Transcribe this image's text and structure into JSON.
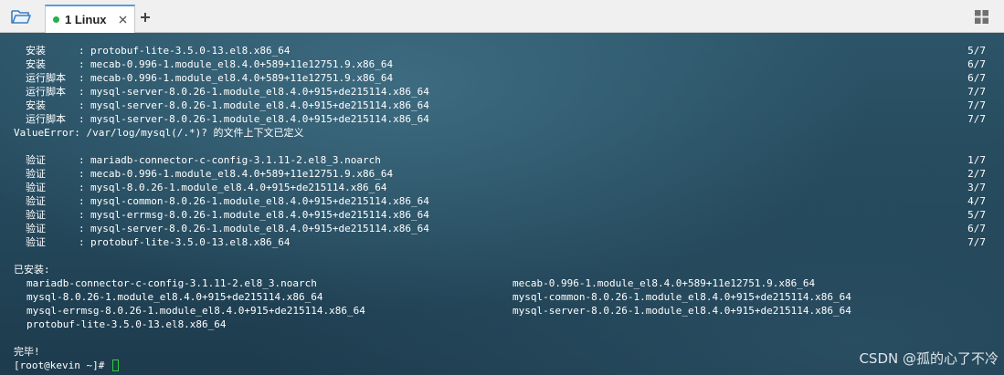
{
  "tabbar": {
    "tab_label": "1 Linux",
    "status_color": "#22b14c",
    "accent_color": "#5b9bd5"
  },
  "transaction": [
    {
      "action": "安装",
      "package": "protobuf-lite-3.5.0-13.el8.x86_64",
      "progress": "5/7"
    },
    {
      "action": "安装",
      "package": "mecab-0.996-1.module_el8.4.0+589+11e12751.9.x86_64",
      "progress": "6/7"
    },
    {
      "action": "运行脚本",
      "package": "mecab-0.996-1.module_el8.4.0+589+11e12751.9.x86_64",
      "progress": "6/7"
    },
    {
      "action": "运行脚本",
      "package": "mysql-server-8.0.26-1.module_el8.4.0+915+de215114.x86_64",
      "progress": "7/7"
    },
    {
      "action": "安装",
      "package": "mysql-server-8.0.26-1.module_el8.4.0+915+de215114.x86_64",
      "progress": "7/7"
    },
    {
      "action": "运行脚本",
      "package": "mysql-server-8.0.26-1.module_el8.4.0+915+de215114.x86_64",
      "progress": "7/7"
    }
  ],
  "error_line": "ValueError: /var/log/mysql(/.*)? 的文件上下文已定义",
  "verify": [
    {
      "action": "验证",
      "package": "mariadb-connector-c-config-3.1.11-2.el8_3.noarch",
      "progress": "1/7"
    },
    {
      "action": "验证",
      "package": "mecab-0.996-1.module_el8.4.0+589+11e12751.9.x86_64",
      "progress": "2/7"
    },
    {
      "action": "验证",
      "package": "mysql-8.0.26-1.module_el8.4.0+915+de215114.x86_64",
      "progress": "3/7"
    },
    {
      "action": "验证",
      "package": "mysql-common-8.0.26-1.module_el8.4.0+915+de215114.x86_64",
      "progress": "4/7"
    },
    {
      "action": "验证",
      "package": "mysql-errmsg-8.0.26-1.module_el8.4.0+915+de215114.x86_64",
      "progress": "5/7"
    },
    {
      "action": "验证",
      "package": "mysql-server-8.0.26-1.module_el8.4.0+915+de215114.x86_64",
      "progress": "6/7"
    },
    {
      "action": "验证",
      "package": "protobuf-lite-3.5.0-13.el8.x86_64",
      "progress": "7/7"
    }
  ],
  "installed_header": "已安装:",
  "installed": [
    [
      "mariadb-connector-c-config-3.1.11-2.el8_3.noarch",
      "mecab-0.996-1.module_el8.4.0+589+11e12751.9.x86_64"
    ],
    [
      "mysql-8.0.26-1.module_el8.4.0+915+de215114.x86_64",
      "mysql-common-8.0.26-1.module_el8.4.0+915+de215114.x86_64"
    ],
    [
      "mysql-errmsg-8.0.26-1.module_el8.4.0+915+de215114.x86_64",
      "mysql-server-8.0.26-1.module_el8.4.0+915+de215114.x86_64"
    ],
    [
      "protobuf-lite-3.5.0-13.el8.x86_64",
      ""
    ]
  ],
  "done_text": "完毕!",
  "prompt": "[root@kevin ~]# ",
  "cursor_color": "#2ecc40",
  "watermark": "CSDN @孤的心了不冷"
}
